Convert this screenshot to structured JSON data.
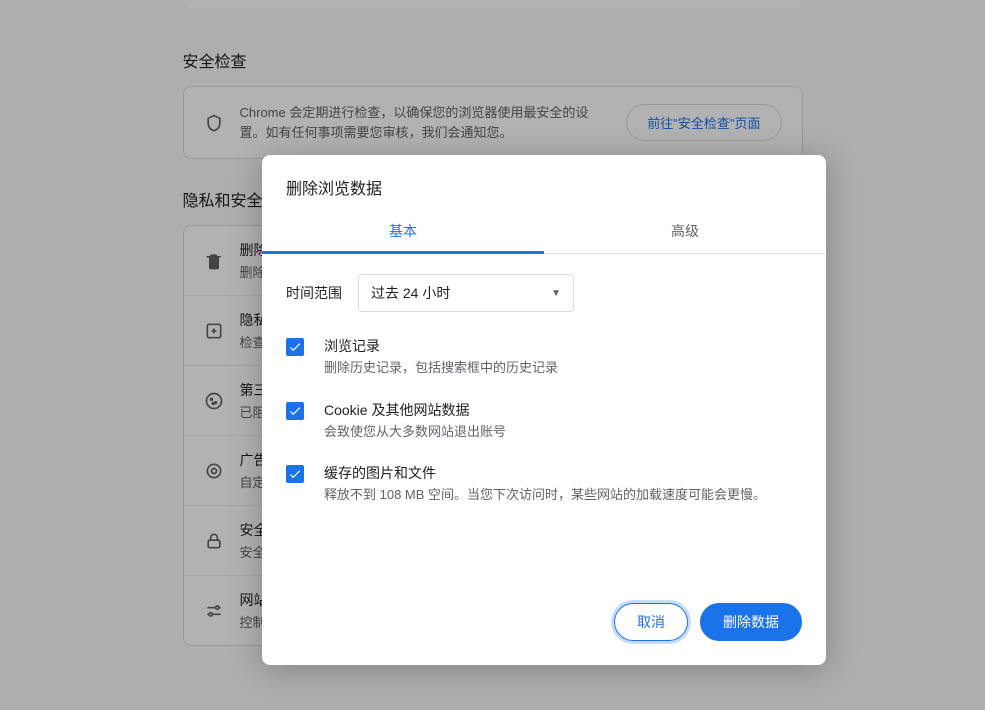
{
  "sections": {
    "safety_check": {
      "title": "安全检查",
      "description": "Chrome 会定期进行检查，以确保您的浏览器使用最安全的设置。如有任何事项需要您审核，我们会通知您。",
      "button": "前往\"安全检查\"页面"
    },
    "privacy_security": {
      "title": "隐私和安全",
      "items": [
        {
          "title": "删除浏览数据",
          "sub": "删除历史记录、Cookie、缓存等"
        },
        {
          "title": "隐私指南",
          "sub": "检查主要的隐私与安全控制项"
        },
        {
          "title": "第三方 Cookie",
          "sub": "已阻止处于无痕模式下的第三方 Cookie"
        },
        {
          "title": "广告隐私",
          "sub": "自定义广告所用信息"
        },
        {
          "title": "安全",
          "sub": "安全浏览及其他安全设置"
        },
        {
          "title": "网站设置",
          "sub": "控制网站可使用的信息及可显示的内容"
        }
      ]
    }
  },
  "dialog": {
    "title": "删除浏览数据",
    "tabs": {
      "basic": "基本",
      "advanced": "高级"
    },
    "time_label": "时间范围",
    "time_value": "过去 24 小时",
    "options": [
      {
        "title": "浏览记录",
        "sub": "删除历史记录，包括搜索框中的历史记录",
        "checked": true
      },
      {
        "title": "Cookie 及其他网站数据",
        "sub": "会致使您从大多数网站退出账号",
        "checked": true
      },
      {
        "title": "缓存的图片和文件",
        "sub": "释放不到 108 MB 空间。当您下次访问时，某些网站的加载速度可能会更慢。",
        "checked": true
      }
    ],
    "cancel": "取消",
    "confirm": "删除数据"
  }
}
